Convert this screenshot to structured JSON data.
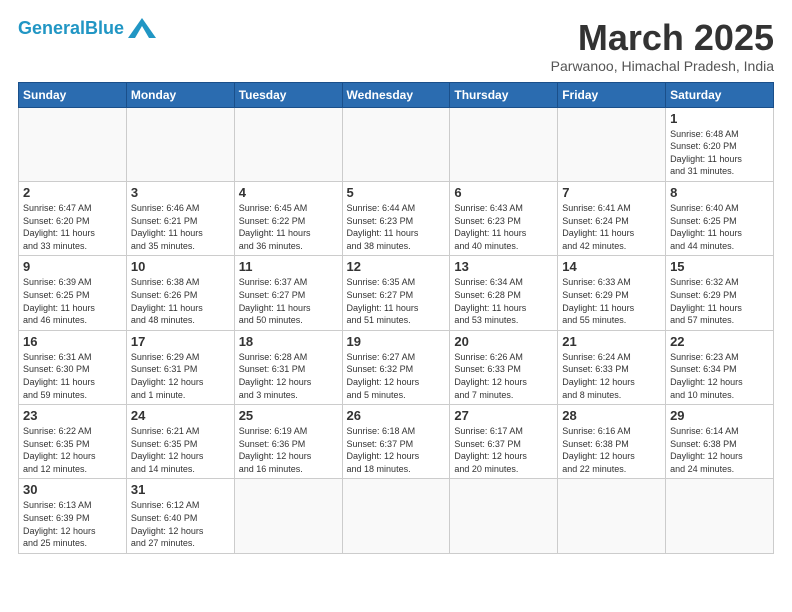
{
  "header": {
    "logo_general": "General",
    "logo_blue": "Blue",
    "month_title": "March 2025",
    "location": "Parwanoo, Himachal Pradesh, India"
  },
  "weekdays": [
    "Sunday",
    "Monday",
    "Tuesday",
    "Wednesday",
    "Thursday",
    "Friday",
    "Saturday"
  ],
  "weeks": [
    [
      {
        "day": "",
        "info": ""
      },
      {
        "day": "",
        "info": ""
      },
      {
        "day": "",
        "info": ""
      },
      {
        "day": "",
        "info": ""
      },
      {
        "day": "",
        "info": ""
      },
      {
        "day": "",
        "info": ""
      },
      {
        "day": "1",
        "info": "Sunrise: 6:48 AM\nSunset: 6:20 PM\nDaylight: 11 hours\nand 31 minutes."
      }
    ],
    [
      {
        "day": "2",
        "info": "Sunrise: 6:47 AM\nSunset: 6:20 PM\nDaylight: 11 hours\nand 33 minutes."
      },
      {
        "day": "3",
        "info": "Sunrise: 6:46 AM\nSunset: 6:21 PM\nDaylight: 11 hours\nand 35 minutes."
      },
      {
        "day": "4",
        "info": "Sunrise: 6:45 AM\nSunset: 6:22 PM\nDaylight: 11 hours\nand 36 minutes."
      },
      {
        "day": "5",
        "info": "Sunrise: 6:44 AM\nSunset: 6:23 PM\nDaylight: 11 hours\nand 38 minutes."
      },
      {
        "day": "6",
        "info": "Sunrise: 6:43 AM\nSunset: 6:23 PM\nDaylight: 11 hours\nand 40 minutes."
      },
      {
        "day": "7",
        "info": "Sunrise: 6:41 AM\nSunset: 6:24 PM\nDaylight: 11 hours\nand 42 minutes."
      },
      {
        "day": "8",
        "info": "Sunrise: 6:40 AM\nSunset: 6:25 PM\nDaylight: 11 hours\nand 44 minutes."
      }
    ],
    [
      {
        "day": "9",
        "info": "Sunrise: 6:39 AM\nSunset: 6:25 PM\nDaylight: 11 hours\nand 46 minutes."
      },
      {
        "day": "10",
        "info": "Sunrise: 6:38 AM\nSunset: 6:26 PM\nDaylight: 11 hours\nand 48 minutes."
      },
      {
        "day": "11",
        "info": "Sunrise: 6:37 AM\nSunset: 6:27 PM\nDaylight: 11 hours\nand 50 minutes."
      },
      {
        "day": "12",
        "info": "Sunrise: 6:35 AM\nSunset: 6:27 PM\nDaylight: 11 hours\nand 51 minutes."
      },
      {
        "day": "13",
        "info": "Sunrise: 6:34 AM\nSunset: 6:28 PM\nDaylight: 11 hours\nand 53 minutes."
      },
      {
        "day": "14",
        "info": "Sunrise: 6:33 AM\nSunset: 6:29 PM\nDaylight: 11 hours\nand 55 minutes."
      },
      {
        "day": "15",
        "info": "Sunrise: 6:32 AM\nSunset: 6:29 PM\nDaylight: 11 hours\nand 57 minutes."
      }
    ],
    [
      {
        "day": "16",
        "info": "Sunrise: 6:31 AM\nSunset: 6:30 PM\nDaylight: 11 hours\nand 59 minutes."
      },
      {
        "day": "17",
        "info": "Sunrise: 6:29 AM\nSunset: 6:31 PM\nDaylight: 12 hours\nand 1 minute."
      },
      {
        "day": "18",
        "info": "Sunrise: 6:28 AM\nSunset: 6:31 PM\nDaylight: 12 hours\nand 3 minutes."
      },
      {
        "day": "19",
        "info": "Sunrise: 6:27 AM\nSunset: 6:32 PM\nDaylight: 12 hours\nand 5 minutes."
      },
      {
        "day": "20",
        "info": "Sunrise: 6:26 AM\nSunset: 6:33 PM\nDaylight: 12 hours\nand 7 minutes."
      },
      {
        "day": "21",
        "info": "Sunrise: 6:24 AM\nSunset: 6:33 PM\nDaylight: 12 hours\nand 8 minutes."
      },
      {
        "day": "22",
        "info": "Sunrise: 6:23 AM\nSunset: 6:34 PM\nDaylight: 12 hours\nand 10 minutes."
      }
    ],
    [
      {
        "day": "23",
        "info": "Sunrise: 6:22 AM\nSunset: 6:35 PM\nDaylight: 12 hours\nand 12 minutes."
      },
      {
        "day": "24",
        "info": "Sunrise: 6:21 AM\nSunset: 6:35 PM\nDaylight: 12 hours\nand 14 minutes."
      },
      {
        "day": "25",
        "info": "Sunrise: 6:19 AM\nSunset: 6:36 PM\nDaylight: 12 hours\nand 16 minutes."
      },
      {
        "day": "26",
        "info": "Sunrise: 6:18 AM\nSunset: 6:37 PM\nDaylight: 12 hours\nand 18 minutes."
      },
      {
        "day": "27",
        "info": "Sunrise: 6:17 AM\nSunset: 6:37 PM\nDaylight: 12 hours\nand 20 minutes."
      },
      {
        "day": "28",
        "info": "Sunrise: 6:16 AM\nSunset: 6:38 PM\nDaylight: 12 hours\nand 22 minutes."
      },
      {
        "day": "29",
        "info": "Sunrise: 6:14 AM\nSunset: 6:38 PM\nDaylight: 12 hours\nand 24 minutes."
      }
    ],
    [
      {
        "day": "30",
        "info": "Sunrise: 6:13 AM\nSunset: 6:39 PM\nDaylight: 12 hours\nand 25 minutes."
      },
      {
        "day": "31",
        "info": "Sunrise: 6:12 AM\nSunset: 6:40 PM\nDaylight: 12 hours\nand 27 minutes."
      },
      {
        "day": "",
        "info": ""
      },
      {
        "day": "",
        "info": ""
      },
      {
        "day": "",
        "info": ""
      },
      {
        "day": "",
        "info": ""
      },
      {
        "day": "",
        "info": ""
      }
    ]
  ]
}
